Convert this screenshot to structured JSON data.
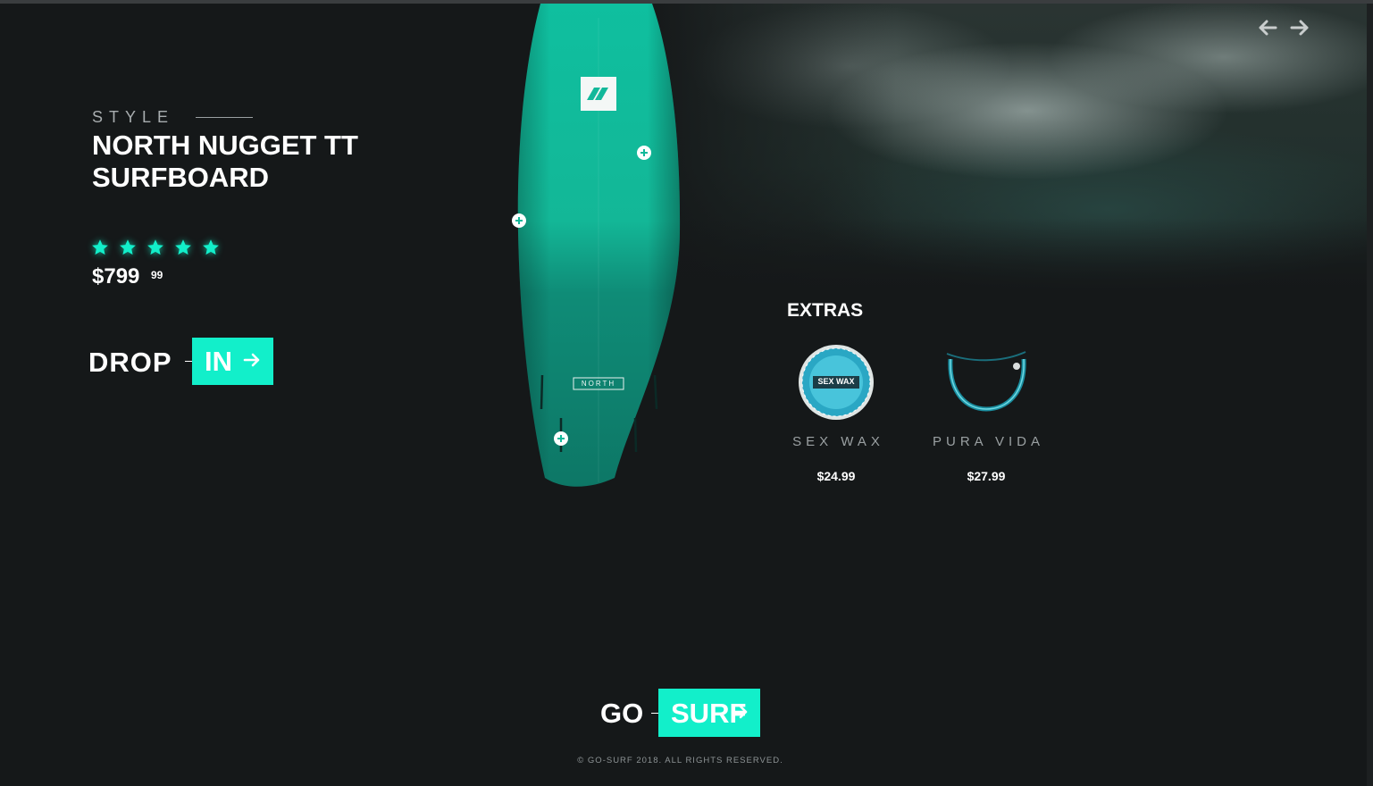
{
  "colors": {
    "accent": "#12efca",
    "background": "#151819",
    "muted_text": "#a8adaf"
  },
  "nav": {
    "prev_icon": "arrow-left-icon",
    "next_icon": "arrow-right-icon"
  },
  "product": {
    "style_label": "STYLE",
    "title": "NORTH NUGGET TT SURFBOARD",
    "rating": 5,
    "rating_max": 5,
    "price_main": "$799",
    "price_cents": "99",
    "board_logo_text": "NORTH"
  },
  "cta": {
    "drop_word": "DROP",
    "drop_button": "IN",
    "go_word": "GO",
    "go_button": "SURF"
  },
  "extras": {
    "title": "EXTRAS",
    "items": [
      {
        "name": "SEX WAX",
        "price": "$24.99",
        "label_text": "SEX WAX"
      },
      {
        "name": "PURA VIDA",
        "price": "$27.99"
      }
    ]
  },
  "footer": {
    "copyright": "© GO-SURF 2018. ALL RIGHTS RESERVED."
  }
}
